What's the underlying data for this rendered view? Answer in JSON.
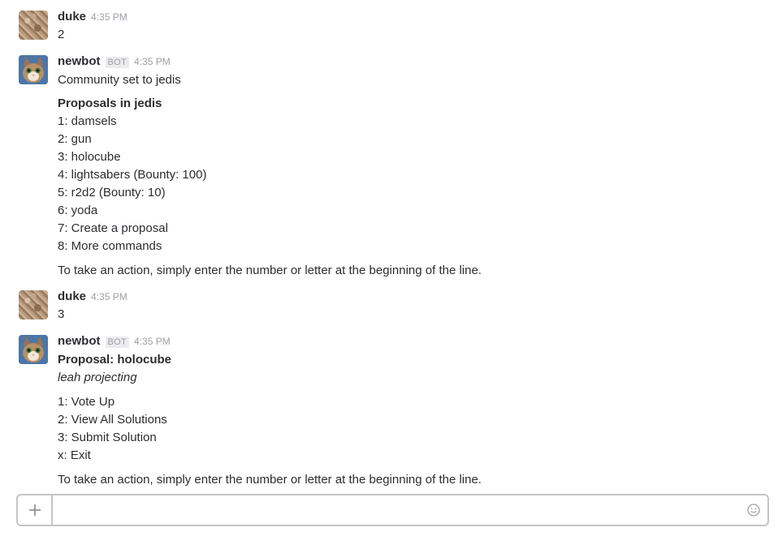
{
  "messages": [
    {
      "author": "duke",
      "time": "4:35 PM",
      "text": "2"
    },
    {
      "author": "newbot",
      "bot_tag": "BOT",
      "time": "4:35 PM",
      "intro": "Community set to jedis",
      "heading": "Proposals in jedis",
      "items": [
        "1: damsels",
        "2: gun",
        "3: holocube",
        "4: lightsabers (Bounty: 100)",
        "5: r2d2 (Bounty: 10)",
        "6: yoda",
        "7: Create a proposal",
        "8: More commands"
      ],
      "footer": "To take an action, simply enter the number or letter at the beginning of the line."
    },
    {
      "author": "duke",
      "time": "4:35 PM",
      "text": "3"
    },
    {
      "author": "newbot",
      "bot_tag": "BOT",
      "time": "4:35 PM",
      "heading": "Proposal: holocube",
      "subtitle": "leah projecting",
      "items": [
        "1: Vote Up",
        "2: View All Solutions",
        "3: Submit Solution",
        "x: Exit"
      ],
      "footer": "To take an action, simply enter the number or letter at the beginning of the line."
    }
  ],
  "composer": {
    "plus_icon": "plus-icon",
    "emoji_icon": "emoji-icon",
    "value": "",
    "placeholder": ""
  }
}
